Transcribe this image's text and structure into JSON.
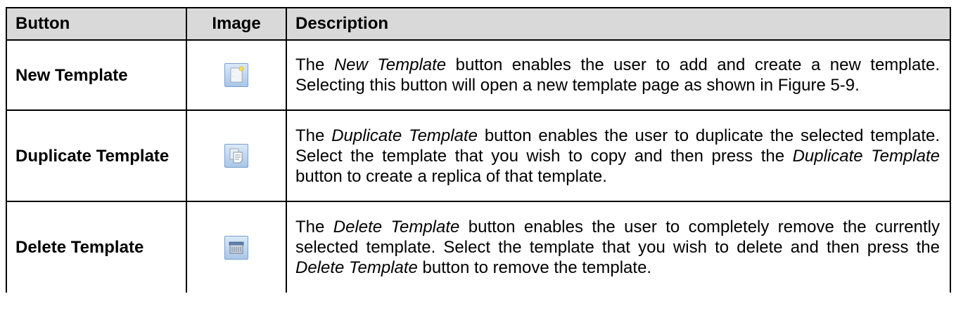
{
  "header": {
    "button": "Button",
    "image": "Image",
    "description": "Description"
  },
  "rows": [
    {
      "button": "New Template",
      "icon": "new-template-icon",
      "desc": [
        {
          "t": "The "
        },
        {
          "t": "New Template",
          "i": true
        },
        {
          "t": " button enables the user to add and create a new template. Selecting this button will open a new template page as shown in Figure 5-9."
        }
      ]
    },
    {
      "button": "Duplicate Template",
      "icon": "duplicate-template-icon",
      "desc": [
        {
          "t": "The "
        },
        {
          "t": "Duplicate Template",
          "i": true
        },
        {
          "t": " button enables the user to duplicate the selected template.  Select the template that you wish to copy and then press the "
        },
        {
          "t": "Duplicate Template",
          "i": true
        },
        {
          "t": " button to create a replica of that template."
        }
      ]
    },
    {
      "button": "Delete Template",
      "icon": "delete-template-icon",
      "desc": [
        {
          "t": "The "
        },
        {
          "t": "Delete Template",
          "i": true
        },
        {
          "t": " button enables the user to completely remove the currently selected template.   Select the template that you wish to delete and then press the "
        },
        {
          "t": "Delete Template",
          "i": true
        },
        {
          "t": " button to remove the template."
        }
      ]
    }
  ]
}
